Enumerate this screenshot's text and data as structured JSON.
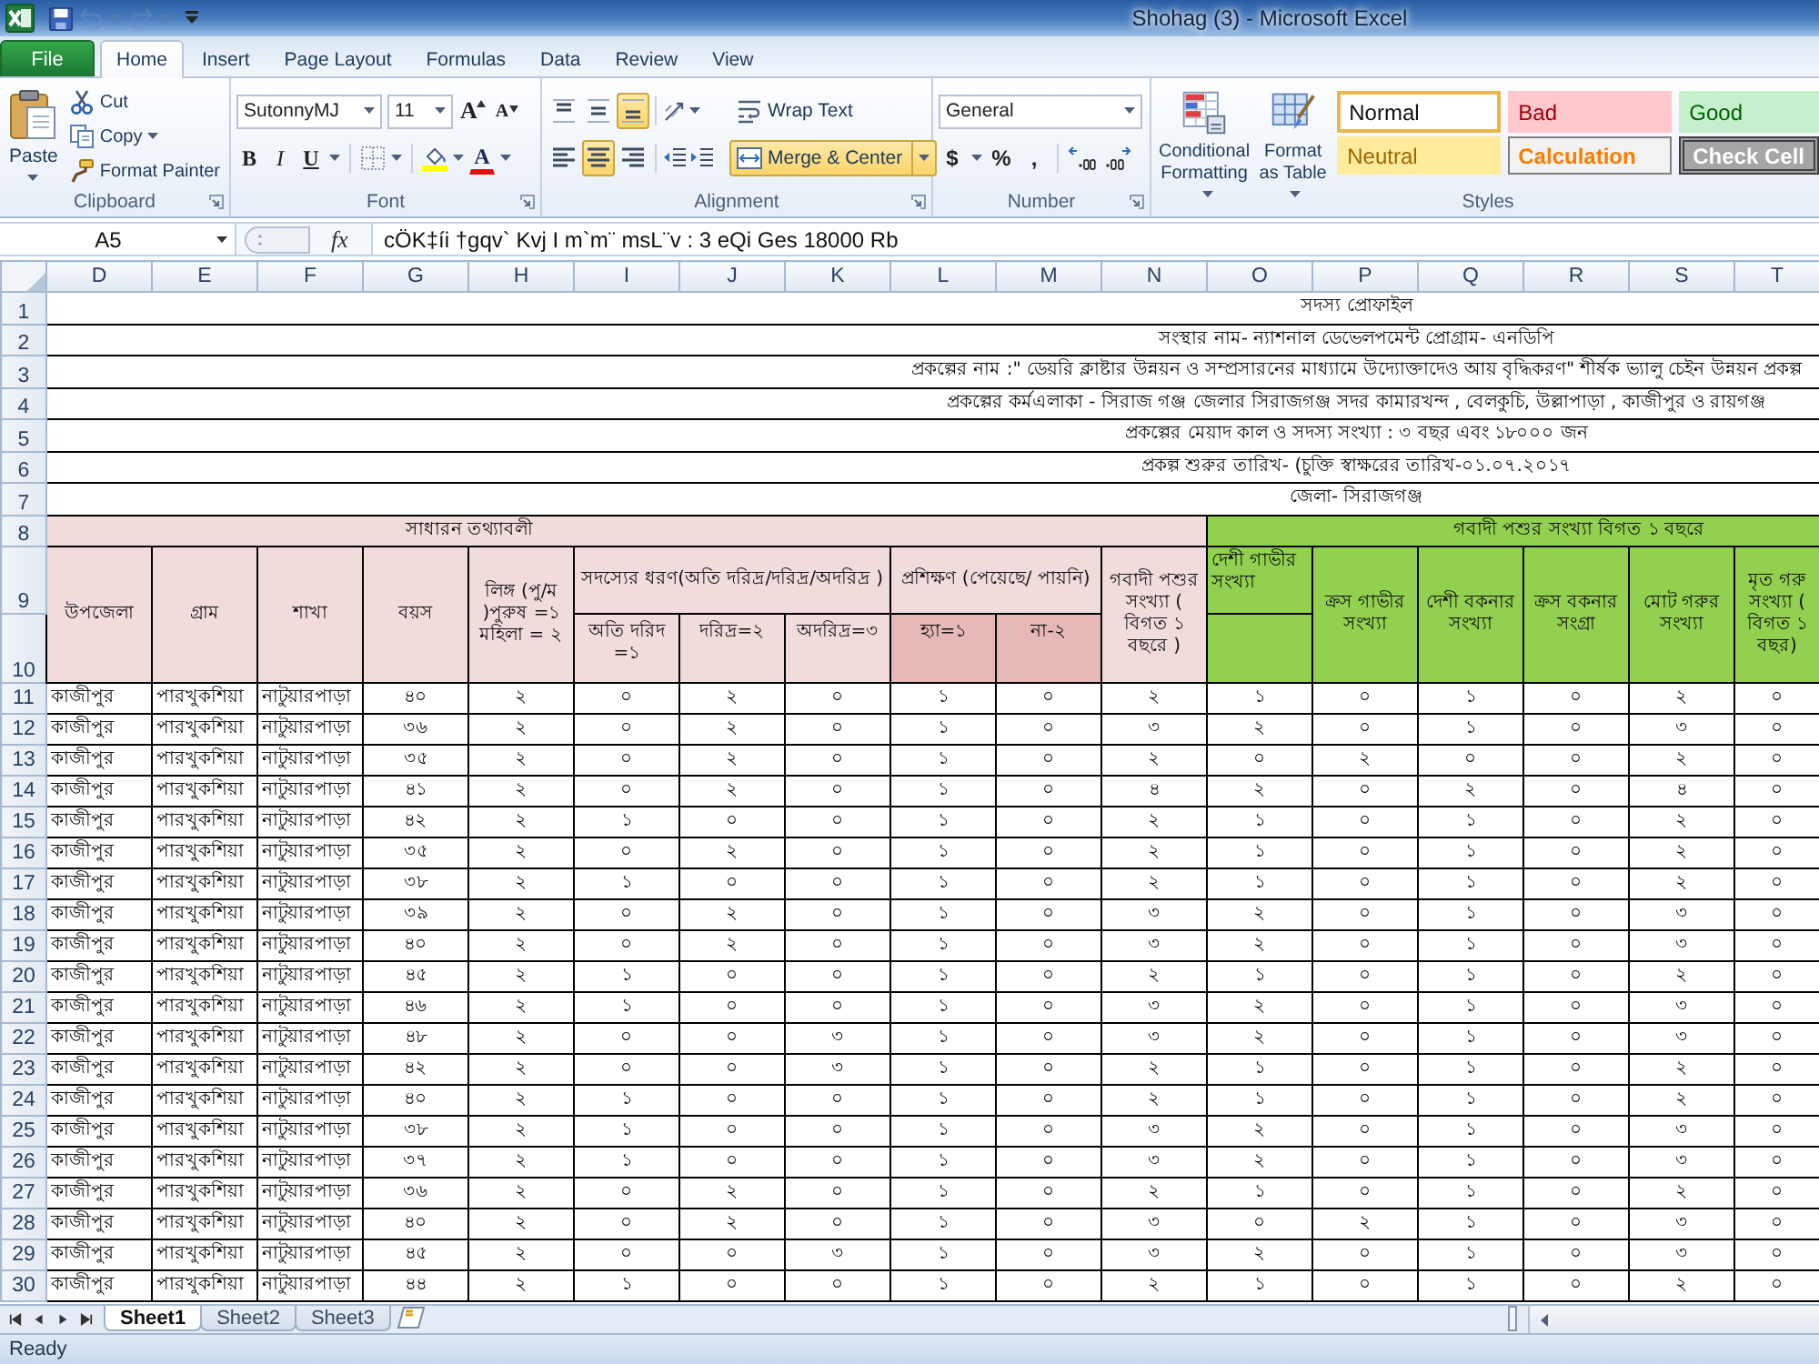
{
  "window": {
    "title": "Shohag (3)  -  Microsoft Excel"
  },
  "quick_access": [
    {
      "kind": "save",
      "disabled": false
    },
    {
      "kind": "undo",
      "disabled": true
    },
    {
      "kind": "redo",
      "disabled": true
    }
  ],
  "ribbon_tabs": [
    {
      "label": "File",
      "kind": "file",
      "selected": false
    },
    {
      "label": "Home",
      "kind": "tab",
      "selected": true
    },
    {
      "label": "Insert",
      "kind": "tab",
      "selected": false
    },
    {
      "label": "Page Layout",
      "kind": "tab",
      "selected": false
    },
    {
      "label": "Formulas",
      "kind": "tab",
      "selected": false
    },
    {
      "label": "Data",
      "kind": "tab",
      "selected": false
    },
    {
      "label": "Review",
      "kind": "tab",
      "selected": false
    },
    {
      "label": "View",
      "kind": "tab",
      "selected": false
    }
  ],
  "ribbon": {
    "clipboard": {
      "label": "Clipboard",
      "paste": "Paste",
      "cut": "Cut",
      "copy": "Copy",
      "format_painter": "Format Painter"
    },
    "font": {
      "label": "Font",
      "font_name": "SutonnyMJ",
      "font_size": "11",
      "grow": "A",
      "shrink": "A",
      "bold": "B",
      "italic": "I",
      "underline": "U",
      "font_color": "A"
    },
    "alignment": {
      "label": "Alignment",
      "vertical": [
        {
          "kind": "top",
          "selected": false
        },
        {
          "kind": "middle",
          "selected": false
        },
        {
          "kind": "bottom",
          "selected": true
        }
      ],
      "horizontal": [
        {
          "kind": "left",
          "selected": false
        },
        {
          "kind": "center",
          "selected": true
        },
        {
          "kind": "right",
          "selected": false
        }
      ],
      "wrap_text": {
        "label": "Wrap Text",
        "on": false
      },
      "merge_center": {
        "label": "Merge & Center",
        "on": true
      }
    },
    "number": {
      "label": "Number",
      "format": "General",
      "currency": "$",
      "percent": "%",
      "comma": ","
    },
    "styles": {
      "label": "Styles",
      "conditional_formatting": "Conditional Formatting",
      "format_as_table": "Format as Table",
      "cell_styles": [
        {
          "label": "Normal",
          "kind": "normal",
          "selected": true
        },
        {
          "label": "Bad",
          "kind": "bad",
          "selected": false
        },
        {
          "label": "Good",
          "kind": "good",
          "selected": false
        },
        {
          "label": "Neutral",
          "kind": "neutral",
          "selected": false
        },
        {
          "label": "Calculation",
          "kind": "calculation",
          "selected": false
        },
        {
          "label": "Check Cell",
          "kind": "check",
          "selected": false
        }
      ]
    }
  },
  "formula_bar": {
    "name_box": "A5",
    "function_label": "fx",
    "formula": "cÖK‡íi †gqv` Kvj I m`m¨ msL¨v : 3 eQi Ges 18000 Rb"
  },
  "sheet": {
    "columns": [
      "D",
      "E",
      "F",
      "G",
      "H",
      "I",
      "J",
      "K",
      "L",
      "M",
      "N",
      "O",
      "P",
      "Q",
      "R",
      "S",
      "T"
    ],
    "title_rows": [
      {
        "row": "1",
        "text": "সদস্য প্রোফাইল"
      },
      {
        "row": "2",
        "text": "সংস্থার নাম- ন্যাশনাল ডেভেলপমেন্ট প্রোগ্রাম- এনডিপি"
      },
      {
        "row": "3",
        "text": "প্রকল্পের নাম :\" ডেয়রি ক্লাষ্টার উন্নয়ন ও সম্প্রসারনের মাধ্যামে উদ্যোক্তাদেও আয় বৃদ্ধিকরণ\" শীর্ষক ভ্যালু চেইন উন্নয়ন প্রকল্প"
      },
      {
        "row": "4",
        "text": "প্রকল্পের কর্মএলাকা - সিরাজ গঞ্জ জেলার সিরাজগঞ্জ সদর কামারখন্দ , বেলকুচি, উল্লাপাড়া , কাজীপুর ও রায়গঞ্জ"
      },
      {
        "row": "5",
        "text": "প্রকল্পের মেয়াদ কাল ও সদস্য সংখ্যা : ৩ বছর এবং ১৮০০০ জন"
      },
      {
        "row": "6",
        "text": "প্রকল্প শুরুর তারিখ- (চুক্তি স্বাক্ষরের তারিখ-০১.০৭.২০১৭"
      },
      {
        "row": "7",
        "text": "জেলা- সিরাজগঞ্জ"
      }
    ],
    "group_row": "8",
    "header_row_numbers": [
      "9",
      "10"
    ],
    "header_groups": [
      {
        "text": "সাধারন তথ্যাবলী",
        "color": "#f2dcdb",
        "headers": [
          {
            "kind": "tall",
            "text": "উপজেলা"
          },
          {
            "kind": "tall",
            "text": "গ্রাম"
          },
          {
            "kind": "tall",
            "text": "শাখা"
          },
          {
            "kind": "tall",
            "text": "বয়স"
          },
          {
            "kind": "tall",
            "text": "লিঙ্গ (পু/ম )পুরুষ =১ মহিলা = ২"
          },
          {
            "kind": "group",
            "text": "সদস্যের ধরণ(অতি দরিদ্র/দরিদ্র/অদরিদ্র )",
            "children": [
              {
                "text": "অতি দরিদ =১",
                "color": "#f2dcdb"
              },
              {
                "text": "দরিদ্র=২",
                "color": "#f2dcdb"
              },
              {
                "text": "অদরিদ্র=৩",
                "color": "#f2dcdb"
              }
            ]
          },
          {
            "kind": "group",
            "text": "প্রশিক্ষণ (পেয়েছে/ পায়নি)",
            "children": [
              {
                "text": "হ্যা=১",
                "color": "#e6b8b7"
              },
              {
                "text": "না-২",
                "color": "#e6b8b7"
              }
            ]
          },
          {
            "kind": "tall",
            "text": "গবাদী পশুর সংখ্যা ( বিগত ১ বছরে )"
          }
        ]
      },
      {
        "text": "গবাদী পশুর  সংখ্যা বিগত ১ বছরে",
        "color": "#92d050",
        "headers": [
          {
            "kind": "split",
            "text": "দেশী গাভীর সংখ্যা"
          },
          {
            "kind": "tall",
            "text": "ক্রস গাভীর সংখ্যা"
          },
          {
            "kind": "tall",
            "text": "দেশী বকনার সংখ্যা"
          },
          {
            "kind": "tall",
            "text": "ক্রস বকনার সংগ্রা"
          },
          {
            "kind": "tall",
            "text": "মোট গরুর সংখ্যা"
          },
          {
            "kind": "tall",
            "text": "মৃত গরু সংখ্যা ( বিগত ১ বছর)"
          }
        ]
      }
    ],
    "rows": [
      {
        "row": "11",
        "cells": [
          "কাজীপুর",
          "পারখুকশিয়া",
          "নাটুয়ারপাড়া",
          "৪০",
          "২",
          "০",
          "২",
          "০",
          "১",
          "০",
          "২",
          "১",
          "০",
          "১",
          "০",
          "২",
          "০"
        ]
      },
      {
        "row": "12",
        "cells": [
          "কাজীপুর",
          "পারখুকশিয়া",
          "নাটুয়ারপাড়া",
          "৩৬",
          "২",
          "০",
          "২",
          "০",
          "১",
          "০",
          "৩",
          "২",
          "০",
          "১",
          "০",
          "৩",
          "০"
        ]
      },
      {
        "row": "13",
        "cells": [
          "কাজীপুর",
          "পারখুকশিয়া",
          "নাটুয়ারপাড়া",
          "৩৫",
          "২",
          "০",
          "২",
          "০",
          "১",
          "০",
          "২",
          "০",
          "২",
          "০",
          "০",
          "২",
          "০"
        ]
      },
      {
        "row": "14",
        "cells": [
          "কাজীপুর",
          "পারখুকশিয়া",
          "নাটুয়ারপাড়া",
          "৪১",
          "২",
          "০",
          "২",
          "০",
          "১",
          "০",
          "৪",
          "২",
          "০",
          "২",
          "০",
          "৪",
          "০"
        ]
      },
      {
        "row": "15",
        "cells": [
          "কাজীপুর",
          "পারখুকশিয়া",
          "নাটুয়ারপাড়া",
          "৪২",
          "২",
          "১",
          "০",
          "০",
          "১",
          "০",
          "২",
          "১",
          "০",
          "১",
          "০",
          "২",
          "০"
        ]
      },
      {
        "row": "16",
        "cells": [
          "কাজীপুর",
          "পারখুকশিয়া",
          "নাটুয়ারপাড়া",
          "৩৫",
          "২",
          "০",
          "২",
          "০",
          "১",
          "০",
          "২",
          "১",
          "০",
          "১",
          "০",
          "২",
          "০"
        ]
      },
      {
        "row": "17",
        "cells": [
          "কাজীপুর",
          "পারখুকশিয়া",
          "নাটুয়ারপাড়া",
          "৩৮",
          "২",
          "১",
          "০",
          "০",
          "১",
          "০",
          "২",
          "১",
          "০",
          "১",
          "০",
          "২",
          "০"
        ]
      },
      {
        "row": "18",
        "cells": [
          "কাজীপুর",
          "পারখুকশিয়া",
          "নাটুয়ারপাড়া",
          "৩৯",
          "২",
          "০",
          "২",
          "০",
          "১",
          "০",
          "৩",
          "২",
          "০",
          "১",
          "০",
          "৩",
          "০"
        ]
      },
      {
        "row": "19",
        "cells": [
          "কাজীপুর",
          "পারখুকশিয়া",
          "নাটুয়ারপাড়া",
          "৪০",
          "২",
          "০",
          "২",
          "০",
          "১",
          "০",
          "৩",
          "২",
          "০",
          "১",
          "০",
          "৩",
          "০"
        ]
      },
      {
        "row": "20",
        "cells": [
          "কাজীপুর",
          "পারখুকশিয়া",
          "নাটুয়ারপাড়া",
          "৪৫",
          "২",
          "১",
          "০",
          "০",
          "১",
          "০",
          "২",
          "১",
          "০",
          "১",
          "০",
          "২",
          "০"
        ]
      },
      {
        "row": "21",
        "cells": [
          "কাজীপুর",
          "পারখুকশিয়া",
          "নাটুয়ারপাড়া",
          "৪৬",
          "২",
          "১",
          "০",
          "০",
          "১",
          "০",
          "৩",
          "২",
          "০",
          "১",
          "০",
          "৩",
          "০"
        ]
      },
      {
        "row": "22",
        "cells": [
          "কাজীপুর",
          "পারখুকশিয়া",
          "নাটুয়ারপাড়া",
          "৪৮",
          "২",
          "০",
          "০",
          "৩",
          "১",
          "০",
          "৩",
          "২",
          "০",
          "১",
          "০",
          "৩",
          "০"
        ]
      },
      {
        "row": "23",
        "cells": [
          "কাজীপুর",
          "পারখুকশিয়া",
          "নাটুয়ারপাড়া",
          "৪২",
          "২",
          "০",
          "০",
          "৩",
          "১",
          "০",
          "২",
          "১",
          "০",
          "১",
          "০",
          "২",
          "০"
        ]
      },
      {
        "row": "24",
        "cells": [
          "কাজীপুর",
          "পারখুকশিয়া",
          "নাটুয়ারপাড়া",
          "৪০",
          "২",
          "১",
          "০",
          "০",
          "১",
          "০",
          "২",
          "১",
          "০",
          "১",
          "০",
          "২",
          "০"
        ]
      },
      {
        "row": "25",
        "cells": [
          "কাজীপুর",
          "পারখুকশিয়া",
          "নাটুয়ারপাড়া",
          "৩৮",
          "২",
          "১",
          "০",
          "০",
          "১",
          "০",
          "৩",
          "২",
          "০",
          "১",
          "০",
          "৩",
          "০"
        ]
      },
      {
        "row": "26",
        "cells": [
          "কাজীপুর",
          "পারখুকশিয়া",
          "নাটুয়ারপাড়া",
          "৩৭",
          "২",
          "১",
          "০",
          "০",
          "১",
          "০",
          "৩",
          "২",
          "০",
          "১",
          "০",
          "৩",
          "০"
        ]
      },
      {
        "row": "27",
        "cells": [
          "কাজীপুর",
          "পারখুকশিয়া",
          "নাটুয়ারপাড়া",
          "৩৬",
          "২",
          "০",
          "২",
          "০",
          "১",
          "০",
          "২",
          "১",
          "০",
          "১",
          "০",
          "২",
          "০"
        ]
      },
      {
        "row": "28",
        "cells": [
          "কাজীপুর",
          "পারখুকশিয়া",
          "নাটুয়ারপাড়া",
          "৪০",
          "২",
          "০",
          "২",
          "০",
          "১",
          "০",
          "৩",
          "০",
          "২",
          "১",
          "০",
          "৩",
          "০"
        ]
      },
      {
        "row": "29",
        "cells": [
          "কাজীপুর",
          "পারখুকশিয়া",
          "নাটুয়ারপাড়া",
          "৪৫",
          "২",
          "০",
          "০",
          "৩",
          "১",
          "০",
          "৩",
          "২",
          "০",
          "১",
          "০",
          "৩",
          "০"
        ]
      },
      {
        "row": "30",
        "cells": [
          "কাজীপুর",
          "পারখুকশিয়া",
          "নাটুয়ারপাড়া",
          "৪৪",
          "২",
          "১",
          "০",
          "০",
          "১",
          "০",
          "২",
          "১",
          "০",
          "১",
          "০",
          "২",
          "০"
        ]
      }
    ]
  },
  "sheet_tabs": [
    {
      "label": "Sheet1",
      "selected": true
    },
    {
      "label": "Sheet2",
      "selected": false
    },
    {
      "label": "Sheet3",
      "selected": false
    }
  ],
  "status_bar": {
    "text": "Ready"
  }
}
